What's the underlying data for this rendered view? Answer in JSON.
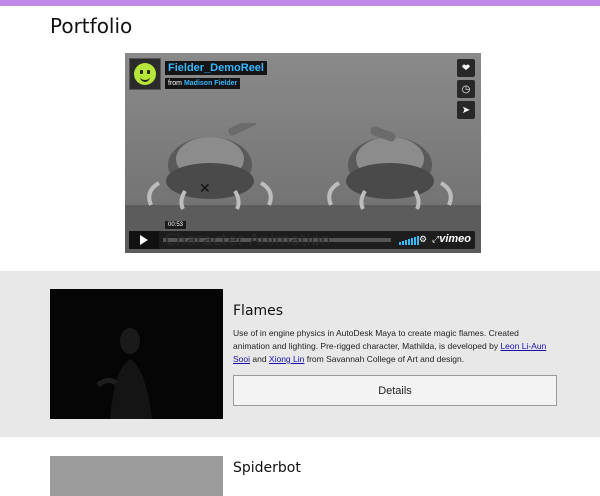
{
  "colors": {
    "accent_bar": "#c089e8",
    "link": "#1a0dab",
    "video_title": "#3ab7ff",
    "band_bg": "#e8e8e8"
  },
  "page": {
    "title": "Portfolio"
  },
  "video": {
    "title": "Fielder_DemoReel",
    "byline_prefix": "from",
    "author": "Madison Fielder",
    "current_time": "00:53",
    "overlay_caption": "Character Animation",
    "brand": "vimeo",
    "progress_fraction": 0.06,
    "side_buttons": [
      "heart-icon",
      "clock-icon",
      "send-icon"
    ]
  },
  "projects": [
    {
      "title": "Flames",
      "desc_before": "Use of in engine physics in AutoDesk Maya to create magic flames. Created animation and lighting. Pre-rigged character, Mathilda, is developed by ",
      "link1": "Leon Li-Aun Sooi",
      "desc_mid": " and ",
      "link2": "Xiong Lin",
      "desc_after": " from Savannah College of Art and design.",
      "button": "Details"
    },
    {
      "title": "Spiderbot"
    }
  ]
}
